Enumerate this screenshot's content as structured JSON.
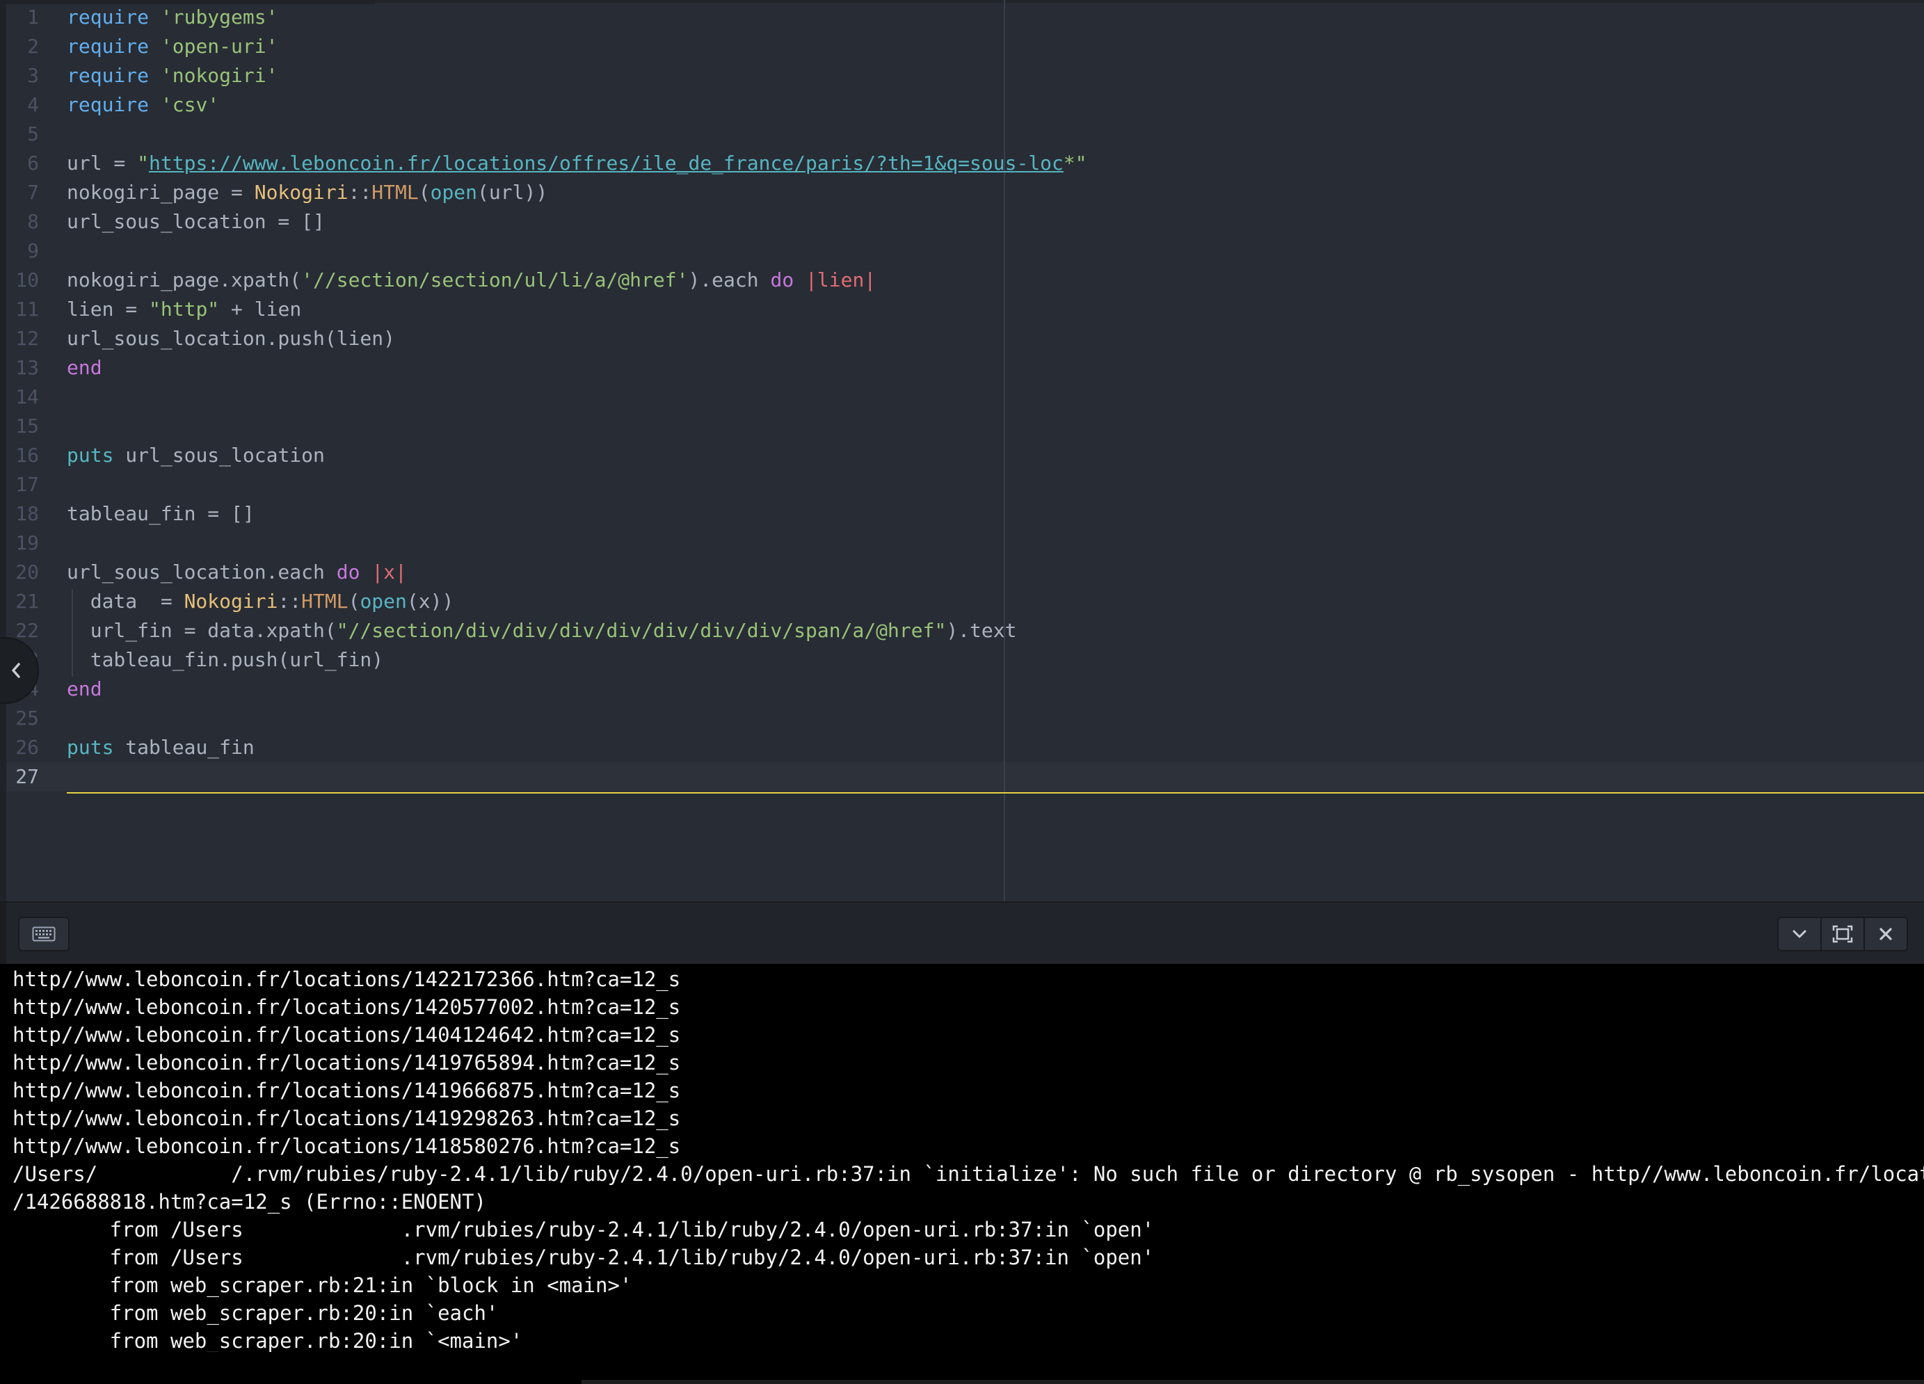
{
  "editor": {
    "lines": [
      {
        "n": "1",
        "tokens": [
          [
            "kw",
            "require"
          ],
          [
            "op",
            " "
          ],
          [
            "str",
            "'rubygems'"
          ]
        ]
      },
      {
        "n": "2",
        "tokens": [
          [
            "kw",
            "require"
          ],
          [
            "op",
            " "
          ],
          [
            "str",
            "'open-uri'"
          ]
        ]
      },
      {
        "n": "3",
        "tokens": [
          [
            "kw",
            "require"
          ],
          [
            "op",
            " "
          ],
          [
            "str",
            "'nokogiri'"
          ]
        ]
      },
      {
        "n": "4",
        "tokens": [
          [
            "kw",
            "require"
          ],
          [
            "op",
            " "
          ],
          [
            "str",
            "'csv'"
          ]
        ]
      },
      {
        "n": "5",
        "tokens": []
      },
      {
        "n": "6",
        "tokens": [
          [
            "op",
            "url = "
          ],
          [
            "str",
            "\""
          ],
          [
            "url",
            "https://www.leboncoin.fr/locations/offres/ile_de_france/paris/?th=1&q=sous-loc"
          ],
          [
            "str",
            "*\""
          ]
        ]
      },
      {
        "n": "7",
        "tokens": [
          [
            "op",
            "nokogiri_page = "
          ],
          [
            "cls",
            "Nokogiri"
          ],
          [
            "op",
            "::"
          ],
          [
            "orn",
            "HTML"
          ],
          [
            "op",
            "("
          ],
          [
            "fn",
            "open"
          ],
          [
            "op",
            "(url))"
          ]
        ]
      },
      {
        "n": "8",
        "tokens": [
          [
            "op",
            "url_sous_location = []"
          ]
        ]
      },
      {
        "n": "9",
        "tokens": []
      },
      {
        "n": "10",
        "tokens": [
          [
            "op",
            "nokogiri_page.xpath("
          ],
          [
            "str",
            "'//section/section/ul/li/a/@href'"
          ],
          [
            "op",
            ").each "
          ],
          [
            "mag",
            "do"
          ],
          [
            "op",
            " "
          ],
          [
            "red",
            "|lien|"
          ]
        ]
      },
      {
        "n": "11",
        "tokens": [
          [
            "op",
            "lien = "
          ],
          [
            "str",
            "\"http\""
          ],
          [
            "op",
            " + lien"
          ]
        ]
      },
      {
        "n": "12",
        "tokens": [
          [
            "op",
            "url_sous_location.push(lien)"
          ]
        ]
      },
      {
        "n": "13",
        "tokens": [
          [
            "mag",
            "end"
          ]
        ]
      },
      {
        "n": "14",
        "tokens": []
      },
      {
        "n": "15",
        "tokens": []
      },
      {
        "n": "16",
        "tokens": [
          [
            "fn",
            "puts"
          ],
          [
            "op",
            " url_sous_location"
          ]
        ]
      },
      {
        "n": "17",
        "tokens": []
      },
      {
        "n": "18",
        "tokens": [
          [
            "op",
            "tableau_fin = []"
          ]
        ]
      },
      {
        "n": "19",
        "tokens": []
      },
      {
        "n": "20",
        "tokens": [
          [
            "op",
            "url_sous_location.each "
          ],
          [
            "mag",
            "do"
          ],
          [
            "op",
            " "
          ],
          [
            "red",
            "|x|"
          ]
        ]
      },
      {
        "n": "21",
        "tokens": [
          [
            "op",
            "  data  = "
          ],
          [
            "cls",
            "Nokogiri"
          ],
          [
            "op",
            "::"
          ],
          [
            "orn",
            "HTML"
          ],
          [
            "op",
            "("
          ],
          [
            "fn",
            "open"
          ],
          [
            "op",
            "(x))"
          ]
        ]
      },
      {
        "n": "22",
        "tokens": [
          [
            "op",
            "  url_fin = data.xpath("
          ],
          [
            "str",
            "\"//section/div/div/div/div/div/div/div/span/a/@href\""
          ],
          [
            "op",
            ").text"
          ]
        ]
      },
      {
        "n": "3",
        "tokens": [
          [
            "op",
            "  tableau_fin.push(url_fin)"
          ]
        ]
      },
      {
        "n": "4",
        "tokens": [
          [
            "mag",
            "end"
          ]
        ]
      },
      {
        "n": "25",
        "tokens": []
      },
      {
        "n": "26",
        "tokens": [
          [
            "fn",
            "puts"
          ],
          [
            "op",
            " tableau_fin"
          ]
        ]
      },
      {
        "n": "27",
        "tokens": [],
        "active": true
      }
    ]
  },
  "terminal": {
    "lines": [
      "http//www.leboncoin.fr/locations/1422172366.htm?ca=12_s",
      "http//www.leboncoin.fr/locations/1420577002.htm?ca=12_s",
      "http//www.leboncoin.fr/locations/1404124642.htm?ca=12_s",
      "http//www.leboncoin.fr/locations/1419765894.htm?ca=12_s",
      "http//www.leboncoin.fr/locations/1419666875.htm?ca=12_s",
      "http//www.leboncoin.fr/locations/1419298263.htm?ca=12_s",
      "http//www.leboncoin.fr/locations/1418580276.htm?ca=12_s",
      "/Users/           /.rvm/rubies/ruby-2.4.1/lib/ruby/2.4.0/open-uri.rb:37:in `initialize': No such file or directory @ rb_sysopen - http//www.leboncoin.fr/locations",
      "/1426688818.htm?ca=12_s (Errno::ENOENT)",
      "        from /Users             .rvm/rubies/ruby-2.4.1/lib/ruby/2.4.0/open-uri.rb:37:in `open'",
      "        from /Users             .rvm/rubies/ruby-2.4.1/lib/ruby/2.4.0/open-uri.rb:37:in `open'",
      "        from web_scraper.rb:21:in `block in <main>'",
      "        from web_scraper.rb:20:in `each'",
      "        from web_scraper.rb:20:in `<main>'"
    ]
  },
  "panel": {
    "buttons": [
      "keyboard-icon",
      "chevron-down-icon",
      "maximize-icon",
      "close-icon"
    ]
  },
  "colors": {
    "editor_bg": "#282c34",
    "keyword": "#61afef",
    "string": "#98c379",
    "control": "#c678dd",
    "param": "#e06c75",
    "class": "#e5c07b",
    "method": "#d19a66",
    "builtin": "#56b6c2",
    "cursor_underline": "#e5d142",
    "terminal_bg": "#000000"
  }
}
